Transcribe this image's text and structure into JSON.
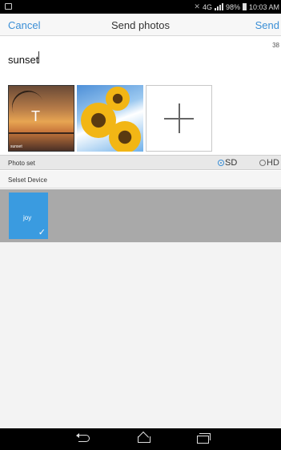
{
  "status_bar": {
    "network": "4G",
    "battery": "98%",
    "time": "10:03 AM",
    "icons": [
      "notification-icon",
      "mute-icon",
      "signal-icon",
      "battery-icon"
    ]
  },
  "header": {
    "cancel_label": "Cancel",
    "title": "Send photos",
    "send_label": "Send"
  },
  "compose": {
    "char_count": "38",
    "caption_value": "sunset"
  },
  "photos": {
    "items": [
      {
        "thumb_label": "sunset",
        "overlay_letter": "T"
      },
      {
        "thumb_label": ""
      }
    ],
    "add_icon": "plus-icon"
  },
  "photo_set": {
    "label": "Photo set",
    "options": [
      {
        "label": "SD",
        "selected": true
      },
      {
        "label": "HD",
        "selected": false
      }
    ]
  },
  "devices": {
    "label": "Selset Device",
    "items": [
      {
        "name": "joy",
        "selected": true
      }
    ]
  },
  "nav_bar": {
    "icons": [
      "back-icon",
      "home-icon",
      "recent-apps-icon"
    ]
  },
  "colors": {
    "accent": "#3b8fd6",
    "device_tile": "#3a9be0",
    "device_area": "#a9a9a9"
  }
}
